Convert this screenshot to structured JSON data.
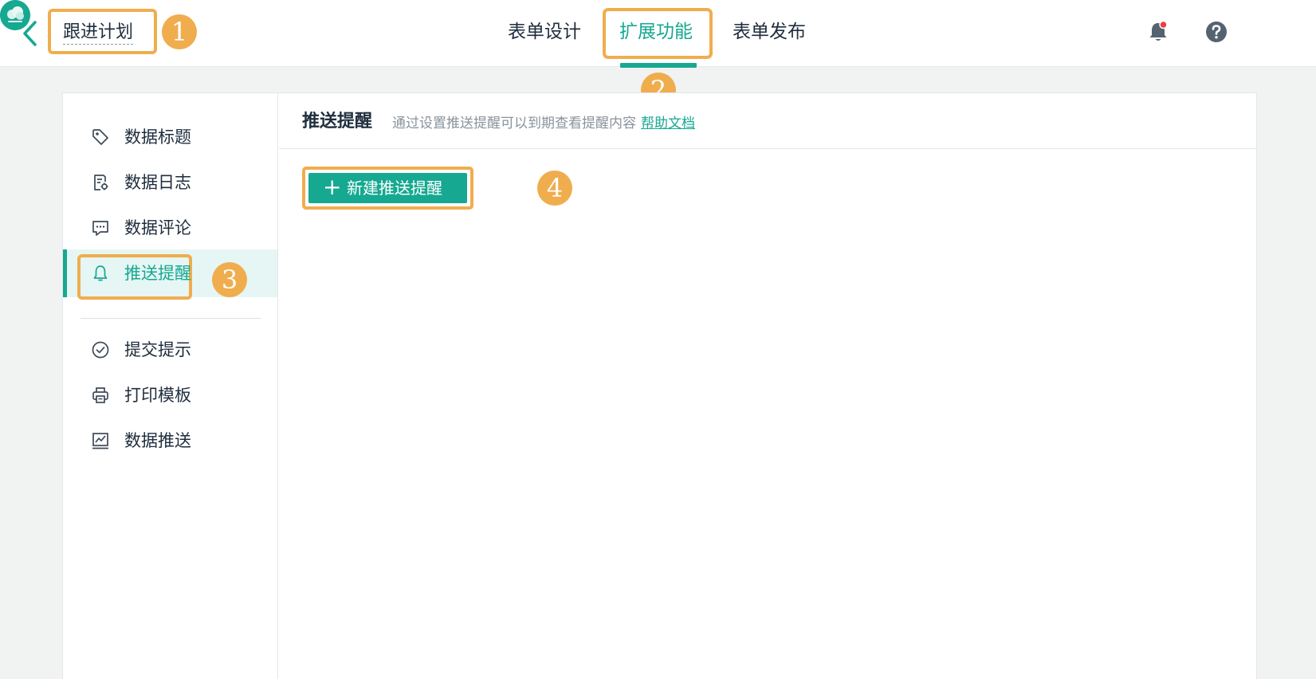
{
  "header": {
    "form_title": "跟进计划",
    "tabs": [
      {
        "label": "表单设计",
        "active": false
      },
      {
        "label": "扩展功能",
        "active": true
      },
      {
        "label": "表单发布",
        "active": false
      }
    ],
    "icons": [
      "bell-icon",
      "help-icon",
      "avatar"
    ]
  },
  "annotations": [
    "1",
    "2",
    "3",
    "4"
  ],
  "sidebar": {
    "items": [
      {
        "label": "数据标题",
        "icon": "tag-icon"
      },
      {
        "label": "数据日志",
        "icon": "log-icon"
      },
      {
        "label": "数据评论",
        "icon": "comment-icon"
      },
      {
        "label": "推送提醒",
        "icon": "bell-icon",
        "active": true
      },
      {
        "label": "提交提示",
        "icon": "check-circle-icon"
      },
      {
        "label": "打印模板",
        "icon": "printer-icon"
      },
      {
        "label": "数据推送",
        "icon": "chart-icon"
      }
    ]
  },
  "main": {
    "title": "推送提醒",
    "description": "通过设置推送提醒可以到期查看提醒内容",
    "help_link": "帮助文档",
    "new_button_label": "新建推送提醒",
    "new_button_symbol": "+"
  },
  "colors": {
    "accent": "#16a891",
    "annotation": "#f0ad4e",
    "notification_dot": "#e8413d"
  }
}
